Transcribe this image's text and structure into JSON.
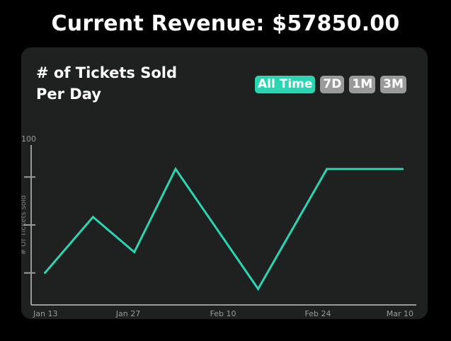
{
  "header": {
    "revenue_text": "Current Revenue: $57850.00"
  },
  "card": {
    "title": "# of Tickets Sold Per Day",
    "filters": [
      {
        "label": "All Time",
        "active": true
      },
      {
        "label": "7D",
        "active": false
      },
      {
        "label": "1M",
        "active": false
      },
      {
        "label": "3M",
        "active": false
      }
    ]
  },
  "colors": {
    "accent": "#2dd4b2",
    "card_bg": "#1f2020",
    "page_bg": "#000000",
    "filter_inactive": "#9a9a9a"
  },
  "chart_data": {
    "type": "line",
    "title": "# of Tickets Sold Per Day",
    "xlabel": "",
    "ylabel": "# Of Tickets sold",
    "x_tick_labels": [
      "Jan 13",
      "Jan 27",
      "Feb 10",
      "Feb 24",
      "Mar 10"
    ],
    "y_tick_labels": [
      "100"
    ],
    "ylim": [
      0,
      100
    ],
    "xlim": [
      "2025-01-13",
      "2025-03-10"
    ],
    "grid": false,
    "series": [
      {
        "x": [
          "2025-01-15",
          "2025-01-22",
          "2025-01-28",
          "2025-02-03",
          "2025-02-15",
          "2025-02-25",
          "2025-03-08"
        ],
        "y": [
          20,
          55,
          33,
          85,
          10,
          85,
          85
        ]
      }
    ]
  }
}
